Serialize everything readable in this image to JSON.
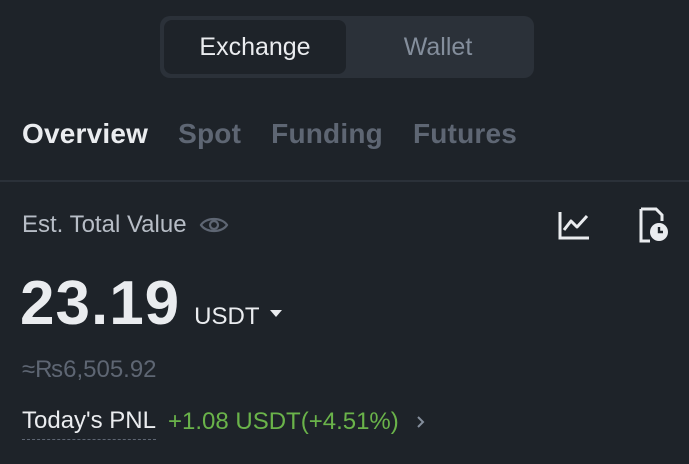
{
  "segmented": {
    "exchange_label": "Exchange",
    "wallet_label": "Wallet"
  },
  "tabs": [
    {
      "label": "Overview",
      "active": true
    },
    {
      "label": "Spot",
      "active": false
    },
    {
      "label": "Funding",
      "active": false
    },
    {
      "label": "Futures",
      "active": false
    }
  ],
  "summary": {
    "est_label": "Est. Total Value",
    "balance": "23.19",
    "currency": "USDT",
    "fiat_equivalent": "≈₨6,505.92",
    "pnl_label": "Today's PNL",
    "pnl_value": "+1.08 USDT(+4.51%)"
  },
  "icons": {
    "eye": "eye-icon",
    "chart": "chart-icon",
    "history": "history-icon",
    "caret": "caret-down-icon",
    "chevron": "chevron-right-icon"
  },
  "colors": {
    "background": "#1e2329",
    "surface": "#2b3139",
    "text_primary": "#eaecef",
    "text_muted": "#5e6673",
    "positive": "#6ab34a"
  }
}
